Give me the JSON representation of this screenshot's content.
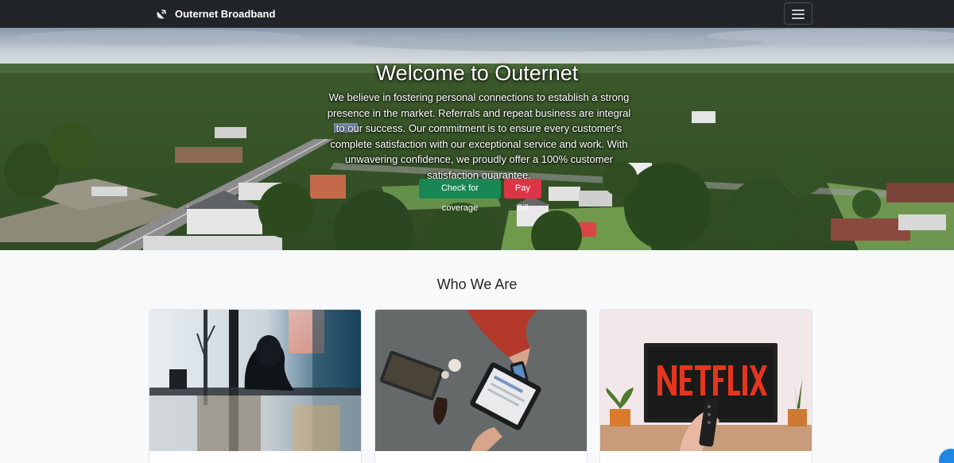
{
  "navbar": {
    "brand_name": "Outernet Broadband",
    "brand_icon": "satellite-dish-icon",
    "menu_icon": "hamburger-menu-icon"
  },
  "hero": {
    "title": "Welcome to Outernet",
    "description": "We believe in fostering personal connections to establish a strong presence in the market. Referrals and repeat business are integral to our success. Our commitment is to ensure every customer's complete satisfaction with our exceptional service and work. With unwavering confidence, we proudly offer a 100% customer satisfaction guarantee.",
    "coverage_button": "Check for coverage",
    "pay_button": "Pay Bill"
  },
  "about": {
    "title": "Who We Are",
    "cards": [
      {
        "image": "person-working-at-desk-silhouette",
        "text": ""
      },
      {
        "image": "tablet-payment-on-table",
        "text": ""
      },
      {
        "image": "remote-streaming-tv",
        "text": ""
      }
    ]
  },
  "colors": {
    "navbar": "#212529",
    "success_button": "#198754",
    "danger_button": "#dc3545",
    "page_background": "#f8f9fa",
    "chat_button": "#1e88e5"
  }
}
